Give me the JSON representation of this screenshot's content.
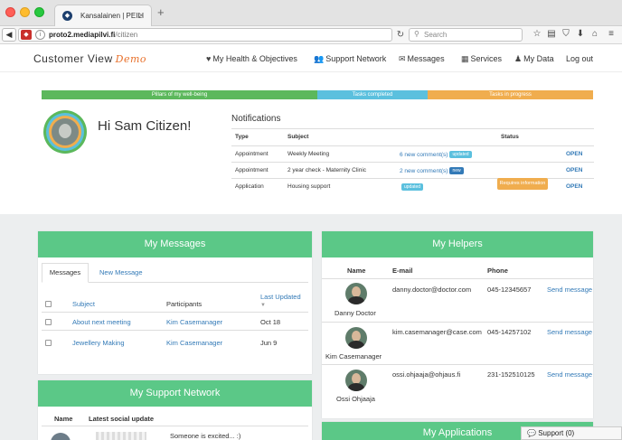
{
  "browser": {
    "tab_title": "Kansalainen | PEILI",
    "url_host": "proto2.mediapilvi.fi",
    "url_path": "/citizen",
    "search_placeholder": "Search"
  },
  "header": {
    "brand": "Customer View",
    "brand_tag": "Demo",
    "nav": [
      {
        "label": "My Health & Objectives",
        "icon": "heart-icon"
      },
      {
        "label": "Support Network",
        "icon": "people-icon"
      },
      {
        "label": "Messages",
        "icon": "envelope-icon"
      },
      {
        "label": "Services",
        "icon": "list-icon"
      },
      {
        "label": "My Data",
        "icon": "user-icon"
      },
      {
        "label": "Log out",
        "icon": ""
      }
    ]
  },
  "progress": {
    "segments": [
      {
        "label": "Pillars of my well-being",
        "color": "#5cb85c"
      },
      {
        "label": "Tasks completed",
        "color": "#5bc0de"
      },
      {
        "label": "Tasks in progress",
        "color": "#f0ad4e"
      }
    ]
  },
  "greeting": "Hi Sam Citizen!",
  "notifications": {
    "title": "Notifications",
    "columns": [
      "Type",
      "Subject",
      "",
      "Status",
      ""
    ],
    "rows": [
      {
        "type": "Appointment",
        "subject": "Weekly Meeting",
        "comments": "6 new comment(s)",
        "badge": "updated",
        "action": "",
        "status": "OPEN"
      },
      {
        "type": "Appointment",
        "subject": "2 year check - Maternity Clinic",
        "comments": "2 new comment(s)",
        "badge": "new",
        "action": "",
        "status": "OPEN"
      },
      {
        "type": "Application",
        "subject": "Housing support",
        "comments": "",
        "badge": "updated",
        "action": "Requires information",
        "status": "OPEN"
      }
    ]
  },
  "my_messages": {
    "title": "My Messages",
    "tabs": [
      "Messages",
      "New Message"
    ],
    "columns": [
      "Subject",
      "Participants",
      "Last Updated"
    ],
    "rows": [
      {
        "subject": "About next meeting",
        "participants": "Kim Casemanager",
        "updated": "Oct 18"
      },
      {
        "subject": "Jewellery Making",
        "participants": "Kim Casemanager",
        "updated": "Jun 9"
      }
    ]
  },
  "my_helpers": {
    "title": "My Helpers",
    "columns": [
      "Name",
      "E-mail",
      "Phone",
      ""
    ],
    "rows": [
      {
        "name": "Danny Doctor",
        "email": "danny.doctor@doctor.com",
        "phone": "045-12345657",
        "action": "Send message"
      },
      {
        "name": "Kim Casemanager",
        "email": "kim.casemanager@case.com",
        "phone": "045-14257102",
        "action": "Send message"
      },
      {
        "name": "Ossi Ohjaaja",
        "email": "ossi.ohjaaja@ohjaus.fi",
        "phone": "231-152510125",
        "action": "Send message"
      }
    ]
  },
  "support_network": {
    "title": "My Support Network",
    "columns": [
      "Name",
      "Latest social update"
    ],
    "update_text": "Someone is excited... :)"
  },
  "my_applications": {
    "title": "My Applications"
  },
  "support_widget": {
    "label": "Support (0)"
  }
}
